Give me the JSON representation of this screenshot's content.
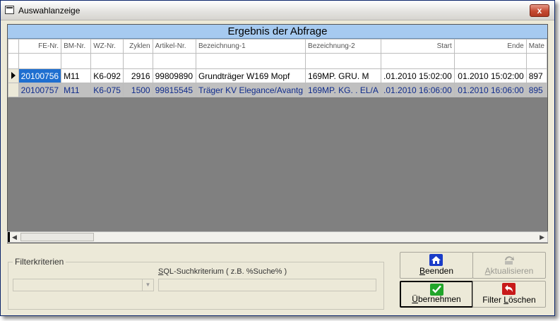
{
  "window": {
    "title": "Auswahlanzeige",
    "close_label": "x"
  },
  "grid": {
    "caption": "Ergebnis der Abfrage",
    "columns": [
      "FE-Nr.",
      "BM-Nr.",
      "WZ-Nr.",
      "Zyklen",
      "Artikel-Nr.",
      "Bezeichnung-1",
      "Bezeichnung-2",
      "Start",
      "Ende",
      "Mate"
    ],
    "rows": [
      [
        "20100756",
        "M11",
        "K6-092",
        "2916",
        "99809890",
        "Grundträger W169 Mopf",
        "169MP. GRU. M",
        ".01.2010 15:02:00",
        "01.2010 15:02:00",
        "897"
      ],
      [
        "20100757",
        "M11",
        "K6-075",
        "1500",
        "99815545",
        "Träger KV Elegance/Avantg",
        "169MP. KG. .  EL/A",
        ".01.2010 16:06:00",
        "01.2010 16:06:00",
        "895"
      ]
    ]
  },
  "filter": {
    "legend": "Filterkriterien",
    "sql_label_prefix": "S",
    "sql_label_rest": "QL-Suchkriterium ( z.B. %Suche% )",
    "combo_value": "",
    "sql_value": ""
  },
  "buttons": {
    "beenden": {
      "accel": "B",
      "rest": "eenden",
      "icon": "home-icon"
    },
    "aktualisieren": {
      "accel": "A",
      "rest": "ktualisieren",
      "icon": "refresh-icon"
    },
    "uebernehmen": {
      "accel": "Ü",
      "rest": "bernehmen",
      "icon": "checkmark-icon"
    },
    "filter_loeschen": {
      "prefix": "Filter ",
      "accel": "L",
      "rest": "öschen",
      "icon": "undo-icon"
    }
  },
  "colors": {
    "caption_bg": "#a6caf0",
    "grid_bg": "#808080",
    "selection": "#1f6fd0",
    "row2_text": "#102c8c"
  }
}
